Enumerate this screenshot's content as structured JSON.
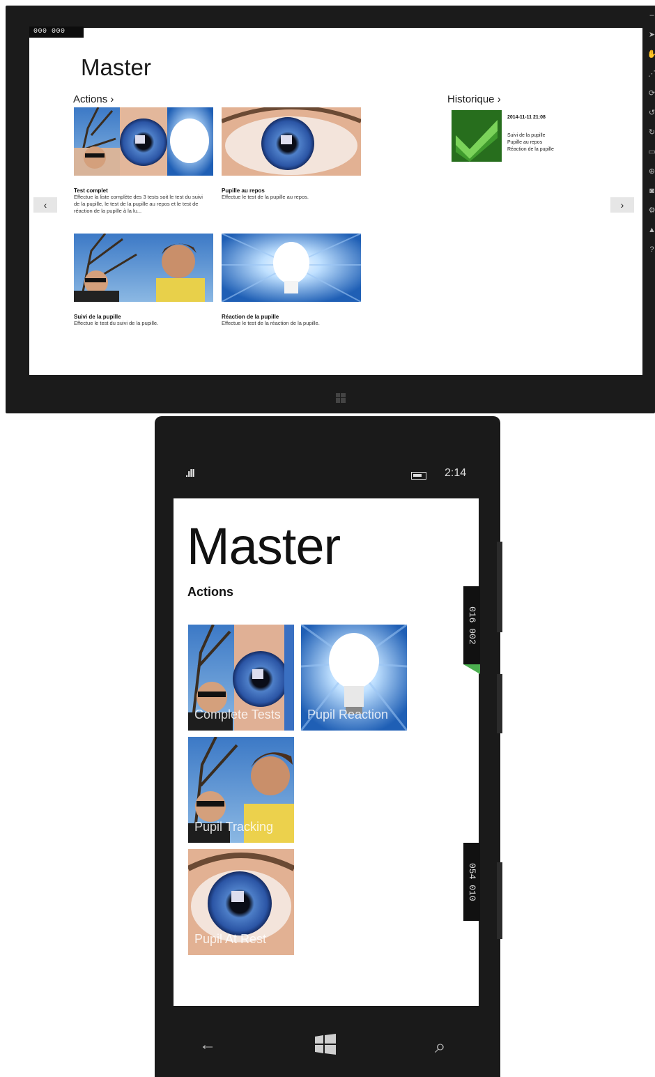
{
  "tablet": {
    "coord_badge": "000 000",
    "title": "Master",
    "actions_header": "Actions ›",
    "history_header": "Historique ›",
    "nav_prev": "‹",
    "nav_next": "›",
    "tiles": [
      {
        "title": "Test complet",
        "desc": "Effectue la liste complète des 3 tests soit le test du suivi de la pupille, le test de la pupille au repos et le test de réaction de la pupille à la lu...",
        "image": "complete-tests"
      },
      {
        "title": "Pupille au repos",
        "desc": "Effectue le test de la pupille au repos.",
        "image": "pupil-at-rest"
      },
      {
        "title": "Suivi de la pupille",
        "desc": "Effectue le test du suivi de la pupille.",
        "image": "pupil-tracking"
      },
      {
        "title": "Réaction de la pupille",
        "desc": "Effectue le test de la réaction de la pupille.",
        "image": "pupil-reaction"
      }
    ],
    "history": {
      "date": "2014-11-11 21:08",
      "lines": [
        "Suivi de la pupille",
        "Pupille au repos",
        "Réaction de la pupille"
      ],
      "icon": "checkmark-icon"
    },
    "toolbar_icons": [
      "pointer-icon",
      "hand-icon",
      "pinch-icon",
      "rotate-icon",
      "rotate-left-icon",
      "rotate-right-icon",
      "fit-icon",
      "resolution-icon",
      "screenshot-icon",
      "settings-icon",
      "network-icon",
      "help-icon"
    ]
  },
  "phone": {
    "status": {
      "signal": ".ıll",
      "time": "2:14",
      "battery_icon": "battery-icon"
    },
    "title": "Master",
    "section": "Actions",
    "tiles": [
      {
        "label": "Complete Tests",
        "image": "complete-tests"
      },
      {
        "label": "Pupil Reaction",
        "image": "pupil-reaction"
      },
      {
        "label": "Pupil Tracking",
        "image": "pupil-tracking"
      },
      {
        "label": "Pupil At Rest",
        "image": "pupil-at-rest"
      }
    ],
    "rulers": [
      {
        "a": "016",
        "b": "002"
      },
      {
        "a": "054",
        "b": "010"
      }
    ],
    "nav": {
      "back": "←",
      "search": "⌕"
    }
  },
  "colors": {
    "accent_green": "#3c8c2a",
    "tile_blue": "#2a5db0",
    "frame": "#1b1b1b"
  }
}
